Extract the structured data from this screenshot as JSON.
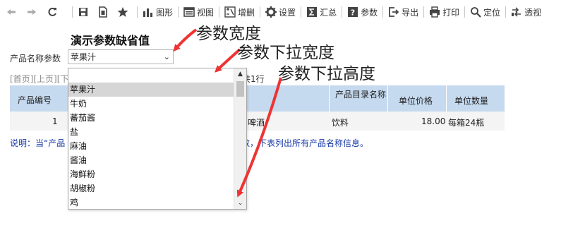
{
  "toolbar": {
    "items": [
      {
        "icon": "save-icon",
        "label": ""
      },
      {
        "icon": "export-page-icon",
        "label": ""
      },
      {
        "icon": "star-icon",
        "label": ""
      },
      {
        "icon": "chart-icon",
        "label": "图形"
      },
      {
        "icon": "view-icon",
        "label": "视图"
      },
      {
        "icon": "edit-table-icon",
        "label": "增删"
      },
      {
        "icon": "gear-icon",
        "label": "设置"
      },
      {
        "icon": "sum-icon",
        "label": "汇总"
      },
      {
        "icon": "help-icon",
        "label": "参数"
      },
      {
        "icon": "export-icon",
        "label": "导出"
      },
      {
        "icon": "print-icon",
        "label": "打印"
      },
      {
        "icon": "locate-icon",
        "label": "定位"
      },
      {
        "icon": "pivot-icon",
        "label": "透视"
      }
    ]
  },
  "report": {
    "title": "演示参数缺省值",
    "param_label": "产品名称参数",
    "param_value": "苹果汁",
    "pager": "[首页][上页][下",
    "row_count": "共1行",
    "columns": {
      "product_id": "产品编号",
      "category": "产品目录名称",
      "price": "单位价格",
      "quantity": "单位数量"
    },
    "row": {
      "id": "1",
      "product": "啤酒",
      "category": "饮料",
      "price": "18.00",
      "quantity": "每箱24瓶"
    },
    "note_head": "说明：当“产品",
    "note_tail": "参数，下表列出所有产品名称信息。"
  },
  "dropdown": {
    "options": [
      "苹果汁",
      "牛奶",
      "蕃茄酱",
      "盐",
      "麻油",
      "酱油",
      "海鲜粉",
      "胡椒粉",
      "鸡"
    ],
    "selected_index": 0
  },
  "annotations": {
    "param_width": "参数宽度",
    "dropdown_width": "参数下拉宽度",
    "dropdown_height": "参数下拉高度"
  },
  "colors": {
    "table_header": "#c5d9ef",
    "note_text": "#1a3aa8",
    "arrow": "#ee3333"
  }
}
